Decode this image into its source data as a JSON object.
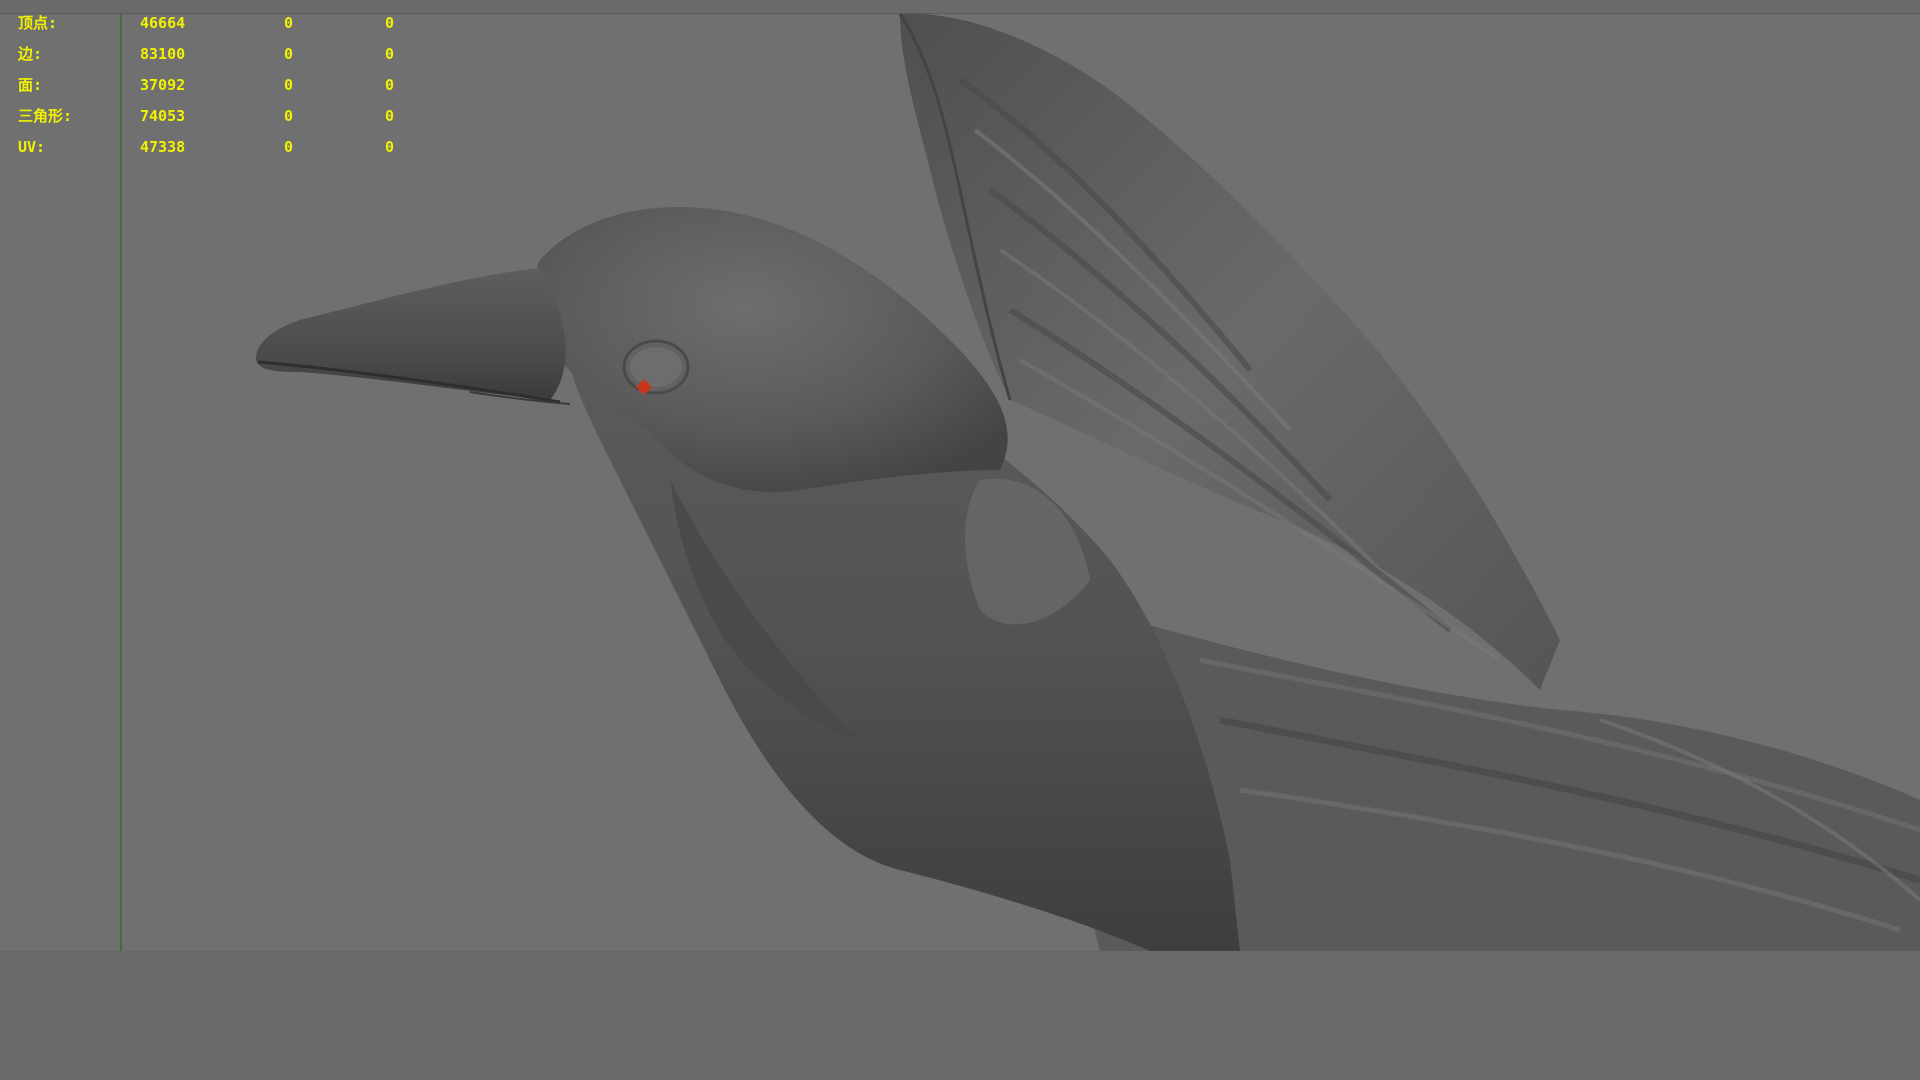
{
  "viewport": {
    "background_color": "#707070",
    "text_color": "#f2f200"
  },
  "poly_count": {
    "rows": [
      {
        "label": "顶点:",
        "total": "46664",
        "selected": "0",
        "components": "0"
      },
      {
        "label": "边:",
        "total": "83100",
        "selected": "0",
        "components": "0"
      },
      {
        "label": "面:",
        "total": "37092",
        "selected": "0",
        "components": "0"
      },
      {
        "label": "三角形:",
        "total": "74053",
        "selected": "0",
        "components": "0"
      },
      {
        "label": "UV:",
        "total": "47338",
        "selected": "0",
        "components": "0"
      }
    ]
  },
  "scene": {
    "model": "raven-3d-model",
    "shading": "smooth-shaded-gray",
    "pivot_marker_color": "#c8361c"
  }
}
